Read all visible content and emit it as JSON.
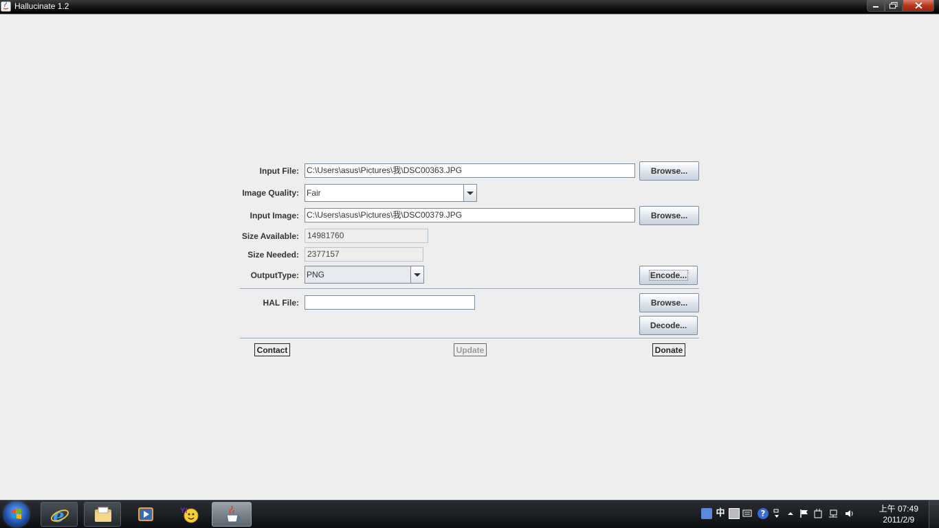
{
  "window": {
    "title": "Hallucinate 1.2",
    "controls": [
      "minimize",
      "maximize",
      "close"
    ]
  },
  "form": {
    "input_file": {
      "label": "Input File:",
      "value": "C:\\Users\\asus\\Pictures\\我\\DSC00363.JPG",
      "browse_label": "Browse..."
    },
    "image_quality": {
      "label": "Image Quality:",
      "selected": "Fair"
    },
    "input_image": {
      "label": "Input Image:",
      "value": "C:\\Users\\asus\\Pictures\\我\\DSC00379.JPG",
      "browse_label": "Browse..."
    },
    "size_available": {
      "label": "Size Available:",
      "value": "14981760"
    },
    "size_needed": {
      "label": "Size Needed:",
      "value": "2377157"
    },
    "output_type": {
      "label": "OutputType:",
      "selected": "PNG"
    },
    "encode_label": "Encode...",
    "hal_file": {
      "label": "HAL File:",
      "value": "",
      "browse_label": "Browse..."
    },
    "decode_label": "Decode..."
  },
  "footer": {
    "contact_label": "Contact",
    "update_label": "Update",
    "donate_label": "Donate"
  },
  "taskbar": {
    "items": [
      "start-button",
      "internet-explorer",
      "windows-explorer",
      "media-player",
      "yahoo-messenger",
      "java-app"
    ],
    "tray": {
      "ime_label": "中",
      "clock_time": "上午 07:49",
      "clock_date": "2011/2/9"
    }
  },
  "colors": {
    "background": "#eeeeee",
    "button_gradient_top": "#ffffff",
    "button_gradient_bottom": "#c8d3df",
    "titlebar": "#101010",
    "close_button": "#b8381f"
  }
}
